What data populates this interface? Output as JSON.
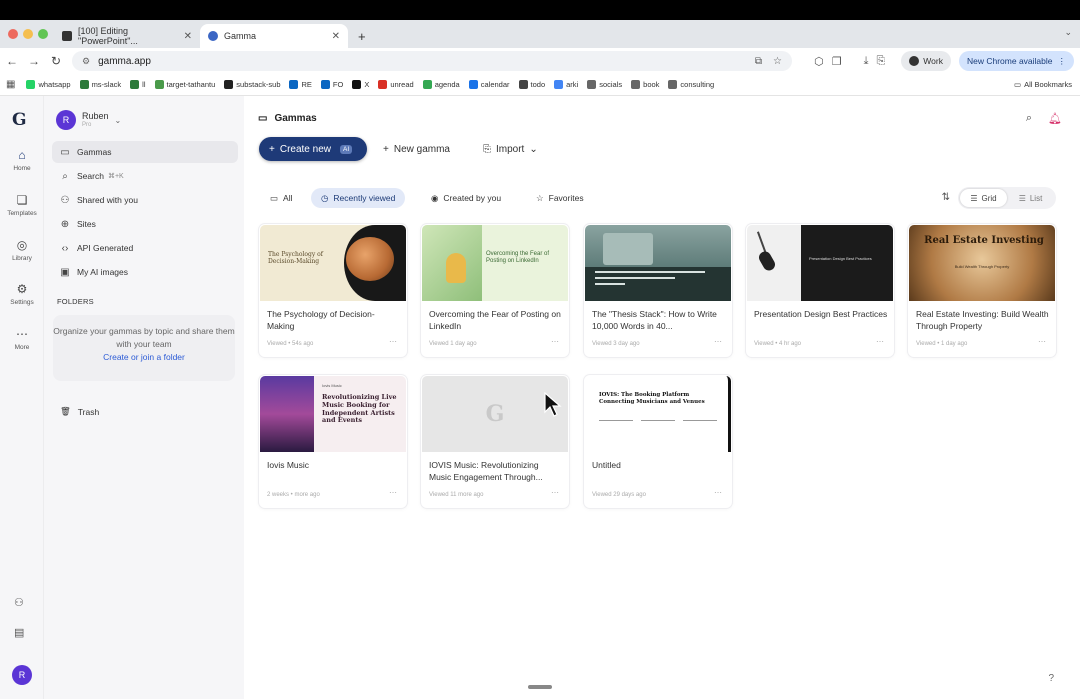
{
  "browser": {
    "tabs": [
      {
        "title": "[100] Editing \"PowerPoint\"...",
        "active": false
      },
      {
        "title": "Gamma",
        "active": true
      }
    ],
    "new_tab": "+",
    "url": "gamma.app",
    "profile": "Work",
    "update_label": "New Chrome available",
    "bookmarks": [
      "whatsapp",
      "ms-slack",
      "ll",
      "target-tathantu",
      "substack-sub",
      "RE",
      "FO",
      "X",
      "unread",
      "agenda",
      "calendar",
      "todo",
      "arki",
      "socials",
      "book",
      "consulting"
    ],
    "all_bookmarks": "All Bookmarks",
    "colors": {
      "bookmark_icons": [
        "#25d366",
        "#2d7a3a",
        "#2d7a3a",
        "#4a9a4a",
        "#222",
        "#0a66c2",
        "#0a66c2",
        "#111",
        "#d93025",
        "#34a853",
        "#1a73e8",
        "#444",
        "#4285f4",
        "#666",
        "#666",
        "#666"
      ]
    }
  },
  "rail": {
    "logo": "G",
    "items": [
      {
        "label": "Home",
        "icon": "home-icon"
      },
      {
        "label": "Templates",
        "icon": "templates-icon"
      },
      {
        "label": "Library",
        "icon": "library-icon"
      },
      {
        "label": "Settings",
        "icon": "settings-icon"
      },
      {
        "label": "More",
        "icon": "more-icon"
      }
    ],
    "avatar_initial": "R"
  },
  "sidebar": {
    "user": {
      "name": "Ruben",
      "sub": "Pro",
      "initial": "R"
    },
    "nav": [
      {
        "label": "Gammas",
        "icon": "gammas-icon",
        "active": true
      },
      {
        "label": "Search",
        "kbd": "⌘+K",
        "icon": "search-icon"
      },
      {
        "label": "Shared with you",
        "icon": "shared-icon"
      },
      {
        "label": "Sites",
        "icon": "globe-icon"
      },
      {
        "label": "API Generated",
        "icon": "code-icon"
      },
      {
        "label": "My AI images",
        "icon": "image-icon"
      }
    ],
    "folders_heading": "FOLDERS",
    "folders_empty": "Organize your gammas by topic and share them with your team",
    "folders_link": "Create or join a folder",
    "trash": "Trash"
  },
  "main": {
    "title": "Gammas",
    "create_new": "Create new",
    "ai_badge": "AI",
    "new_gamma": "New gamma",
    "import": "Import",
    "filters": [
      {
        "label": "All",
        "active": false
      },
      {
        "label": "Recently viewed",
        "active": true
      },
      {
        "label": "Created by you",
        "active": false
      },
      {
        "label": "Favorites",
        "active": false
      }
    ],
    "view": {
      "grid": "Grid",
      "list": "List"
    },
    "cards": [
      {
        "title": "The Psychology of Decision-Making",
        "meta": "Viewed • 54s ago",
        "thumb_text": "The Psychology of Decision-Making"
      },
      {
        "title": "Overcoming the Fear of Posting on LinkedIn",
        "meta": "Viewed 1 day ago",
        "thumb_text": "Overcoming the Fear of Posting on LinkedIn"
      },
      {
        "title": "The \"Thesis Stack\": How to Write 10,000 Words in 40...",
        "meta": "Viewed 3 day ago",
        "thumb_text": ""
      },
      {
        "title": "Presentation Design Best Practices",
        "meta": "Viewed • 4 hr ago",
        "thumb_text": "Presentation Design Best Practices"
      },
      {
        "title": "Real Estate Investing: Build Wealth Through Property",
        "meta": "Viewed • 1 day ago",
        "thumb_text": "Real Estate Investing",
        "thumb_sub": "Build Wealth Through Property"
      },
      {
        "title": "Iovis Music",
        "meta": "2 weeks • more ago",
        "thumb_text": "Revolutionizing Live Music Booking for Independent Artists and Events",
        "thumb_kicker": "Iovis Music"
      },
      {
        "title": "IOVIS Music: Revolutionizing Music Engagement Through...",
        "meta": "Viewed 11 more ago",
        "thumb_text": ""
      },
      {
        "title": "Untitled",
        "meta": "Viewed 29 days ago",
        "thumb_text": "IOVIS: The Booking Platform Connecting Musicians and Venues"
      }
    ]
  }
}
